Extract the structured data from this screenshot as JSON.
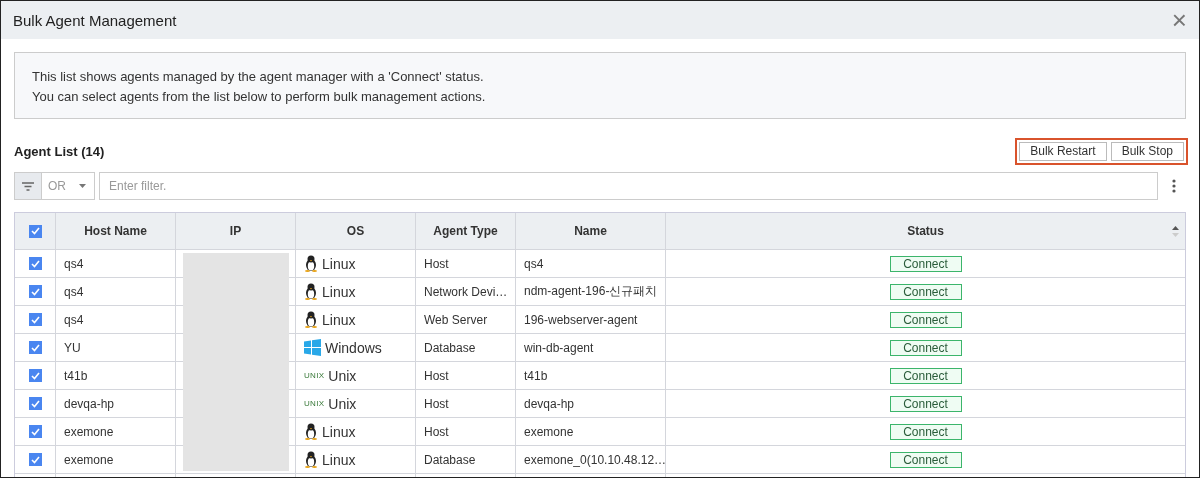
{
  "window": {
    "title": "Bulk Agent Management",
    "close": "×"
  },
  "info": [
    "This list shows agents managed by the agent manager with a 'Connect' status.",
    "You can select agents from the list below to perform bulk management actions."
  ],
  "list_title": "Agent List (14)",
  "actions": [
    "Bulk Restart",
    "Bulk Stop"
  ],
  "filter": {
    "operator": "OR",
    "placeholder": "Enter filter."
  },
  "table": {
    "all_checked": true,
    "columns": [
      "Host Name",
      "IP",
      "OS",
      "Agent Type",
      "Name",
      "Status"
    ],
    "rows": [
      {
        "checked": true,
        "host": "qs4",
        "os": {
          "kind": "linux",
          "label": "Linux"
        },
        "agent_type": "Host",
        "name": "qs4",
        "status": "Connect"
      },
      {
        "checked": true,
        "host": "qs4",
        "os": {
          "kind": "linux",
          "label": "Linux"
        },
        "agent_type": "Network Devi…",
        "name": "ndm-agent-196-신규패치",
        "status": "Connect"
      },
      {
        "checked": true,
        "host": "qs4",
        "os": {
          "kind": "linux",
          "label": "Linux"
        },
        "agent_type": "Web Server",
        "name": "196-webserver-agent",
        "status": "Connect"
      },
      {
        "checked": true,
        "host": "YU",
        "os": {
          "kind": "windows",
          "label": "Windows"
        },
        "agent_type": "Database",
        "name": "win-db-agent",
        "status": "Connect"
      },
      {
        "checked": true,
        "host": "t41b",
        "os": {
          "kind": "unix",
          "label": "Unix",
          "logo": "UNIX"
        },
        "agent_type": "Host",
        "name": "t41b",
        "status": "Connect"
      },
      {
        "checked": true,
        "host": "devqa-hp",
        "os": {
          "kind": "unix",
          "label": "Unix",
          "logo": "UNIX"
        },
        "agent_type": "Host",
        "name": "devqa-hp",
        "status": "Connect"
      },
      {
        "checked": true,
        "host": "exemone",
        "os": {
          "kind": "linux",
          "label": "Linux"
        },
        "agent_type": "Host",
        "name": "exemone",
        "status": "Connect"
      },
      {
        "checked": true,
        "host": "exemone",
        "os": {
          "kind": "linux",
          "label": "Linux"
        },
        "agent_type": "Database",
        "name": "exemone_0(10.10.48.12…",
        "status": "Connect"
      }
    ]
  }
}
